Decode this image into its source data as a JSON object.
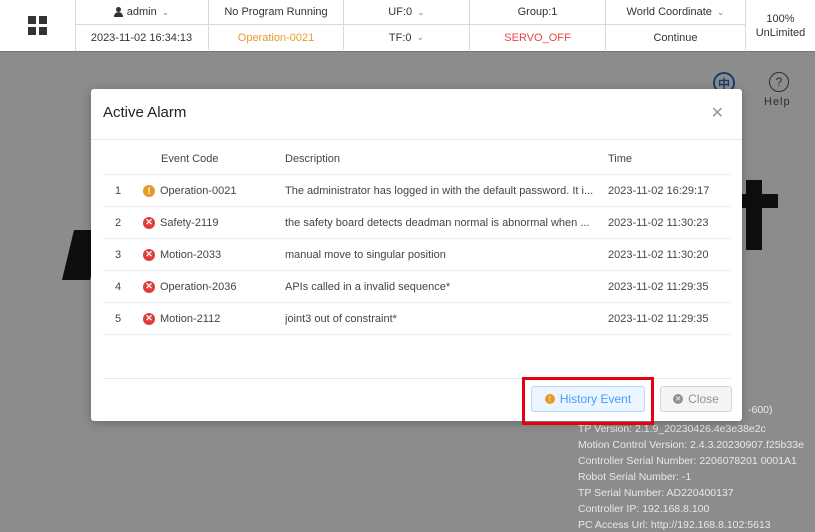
{
  "topbar": {
    "user": "admin",
    "datetime": "2023-11-02 16:34:13",
    "program_status": "No Program Running",
    "operation_code": "Operation-0021",
    "uf": "UF:0",
    "tf": "TF:0",
    "group": "Group:1",
    "servo": "SERVO_OFF",
    "coordinate": "World Coordinate",
    "continue_label": "Continue",
    "speed": "100%",
    "limit": "UnLimited"
  },
  "background": {
    "lang_glyph": "中",
    "help_label": "Help",
    "info_lines": [
      "-600)",
      "TP Version: 2.1.9_20230426.4e3e38e2c",
      "Motion Control Version: 2.4.3.20230907.f25b33e",
      "Controller Serial Number: 2206078201 0001A1",
      "Robot Serial Number: -1",
      "TP Serial Number: AD220400137",
      "Controller IP: 192.168.8.100",
      "PC Access Url: http://192.168.8.102:5613"
    ]
  },
  "dialog": {
    "title": "Active Alarm",
    "columns": {
      "code": "Event Code",
      "description": "Description",
      "time": "Time"
    },
    "rows": [
      {
        "index": "1",
        "level": "warn",
        "code": "Operation-0021",
        "description": "The administrator has logged in with the default password. It i...",
        "time": "2023-11-02 16:29:17"
      },
      {
        "index": "2",
        "level": "error",
        "code": "Safety-2119",
        "description": "the safety board detects deadman normal is abnormal when ...",
        "time": "2023-11-02 11:30:23"
      },
      {
        "index": "3",
        "level": "error",
        "code": "Motion-2033",
        "description": "manual move to singular position",
        "time": "2023-11-02 11:30:20"
      },
      {
        "index": "4",
        "level": "error",
        "code": "Operation-2036",
        "description": "APIs called in a invalid sequence*",
        "time": "2023-11-02 11:29:35"
      },
      {
        "index": "5",
        "level": "error",
        "code": "Motion-2112",
        "description": "joint3 out of constraint*",
        "time": "2023-11-02 11:29:35"
      }
    ],
    "history_button": "History Event",
    "close_button": "Close"
  },
  "colors": {
    "accent": "#409eff",
    "warn": "#e89a28",
    "error": "#e23b3b",
    "highlight": "#e3000f"
  }
}
